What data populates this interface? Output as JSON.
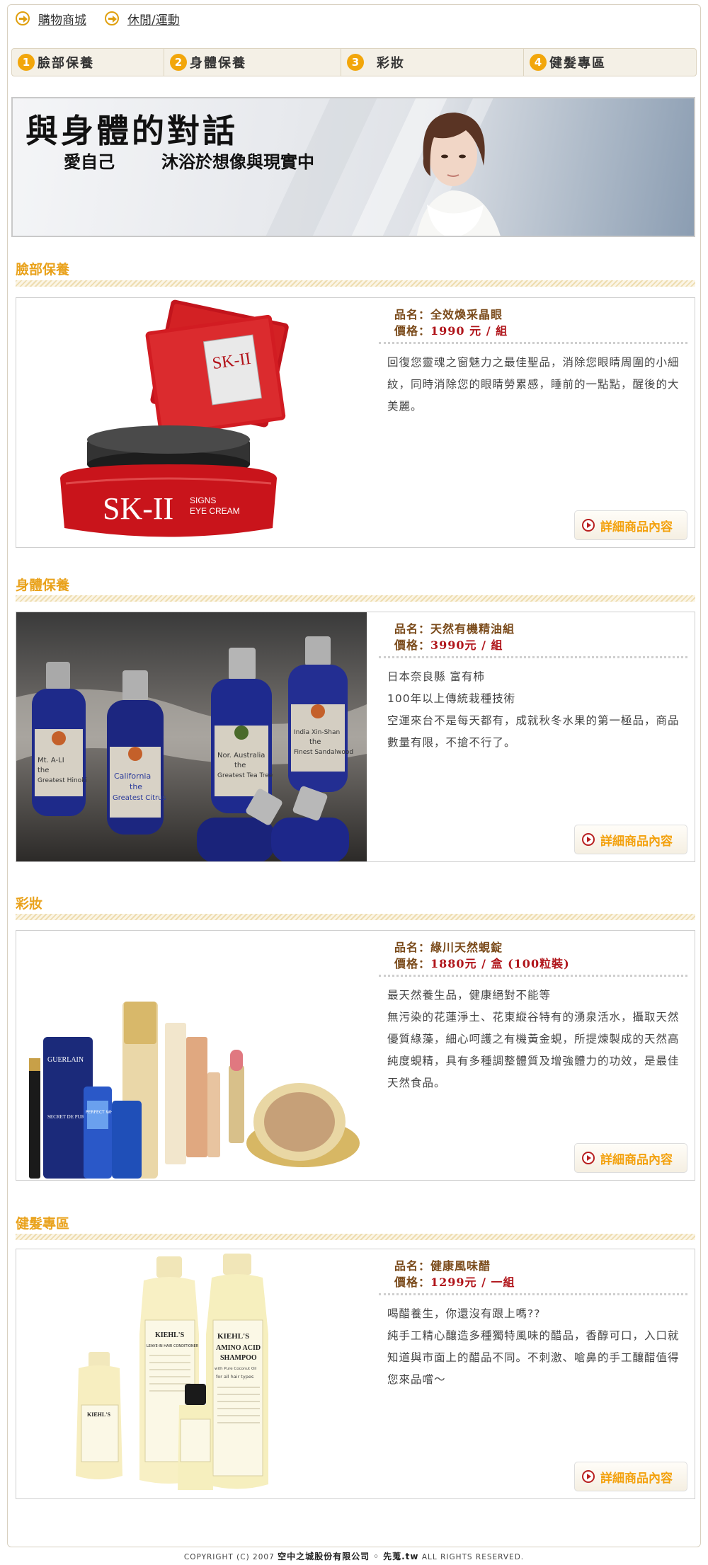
{
  "breadcrumb": [
    {
      "label": "購物商城",
      "icon": "arrow-right-icon"
    },
    {
      "label": "休閒/運動",
      "icon": "arrow-right-icon"
    }
  ],
  "tabs": [
    {
      "num": "1",
      "label": "臉部保養"
    },
    {
      "num": "2",
      "label": "身體保養"
    },
    {
      "num": "3",
      "label": "彩妝"
    },
    {
      "num": "4",
      "label": "健髮專區"
    }
  ],
  "banner": {
    "title": "與身體的對話",
    "sub1": "愛自己",
    "sub2": "沐浴於想像與現實中"
  },
  "sections": [
    {
      "title": "臉部保養",
      "name_label": "品名：",
      "name": "全效煥采晶眼",
      "price_label": "價格：",
      "price": "1990 元 / 組",
      "desc": [
        "回復您靈魂之窗魅力之最佳聖品，消除您眼睛周圍的小細紋，同時消除您的眼睛勞累感，睡前的一點點，醒後的大美麗。"
      ],
      "button": "詳細商品內容",
      "pack_text": "SK-II",
      "jar_text1": "SK-II",
      "jar_text2": "SIGNS",
      "jar_text3": "EYE CREAM"
    },
    {
      "title": "身體保養",
      "name_label": "品名：",
      "name": "天然有機精油組",
      "price_label": "價格：",
      "price": "3990元 / 組",
      "desc": [
        "日本奈良縣 富有柿",
        "100年以上傳統栽種技術",
        "空運來台不是每天都有，成就秋冬水果的第一極品，商品數量有限，不搶不行了。"
      ],
      "button": "詳細商品內容",
      "bottles": [
        "Mt. A-LI the Greatest Hinoki",
        "California the Greatest Citrus",
        "Nor. Australia the Greatest Tea Tree",
        "India Xin-Shan the Finest Sandalwood"
      ]
    },
    {
      "title": "彩妝",
      "name_label": "品名：",
      "name": "綠川天然蜆錠",
      "price_label": "價格：",
      "price": "1880元 / 盒 (100粒裝)",
      "desc": [
        "最天然養生品，健康絕對不能等",
        "無污染的花蓮淨土、花東縱谷特有的湧泉活水，攝取天然優質綠藻，細心呵護之有機黃金蜆，所提煉製成的天然高純度蜆精，具有多種調整體質及增強體力的功效，是最佳天然食品。"
      ],
      "button": "詳細商品內容",
      "brand1": "GUERLAIN",
      "brand2": "SECRET DE PURETE",
      "brand3": "PERFECT WHITE"
    },
    {
      "title": "健髮專區",
      "name_label": "品名：",
      "name": "健康風味醋",
      "price_label": "價格：",
      "price": "1299元 / 一組",
      "desc": [
        "喝醋養生，你還沒有跟上嗎??",
        "純手工精心釀造多種獨特風味的醋品，香醇可口，入口就知道與市面上的醋品不同。不刺激、嗆鼻的手工釀醋值得您來品嚐～"
      ],
      "button": "詳細商品內容",
      "label_big1": "KIEHL'S",
      "label_big2": "AMINO ACID",
      "label_big3": "SHAMPOO",
      "label_big4": "with Pure Coconut Oil",
      "label_big5": "for all hair types",
      "label_mid1": "KIEHL'S",
      "label_mid2": "LEAVE-IN HAIR CONDITIONER",
      "label_small": "KIEHL'S"
    }
  ],
  "footer": {
    "prefix": "COPYRIGHT (C) 2007",
    "company": "空中之城股份有限公司 ◦ 先蒐.tw",
    "suffix": "ALL RIGHTS RESERVED."
  },
  "colors": {
    "accent": "#e9a21c",
    "price_red": "#b0141a",
    "name_brown": "#7a4a1a",
    "tab_bg": "#f4f0e6"
  }
}
